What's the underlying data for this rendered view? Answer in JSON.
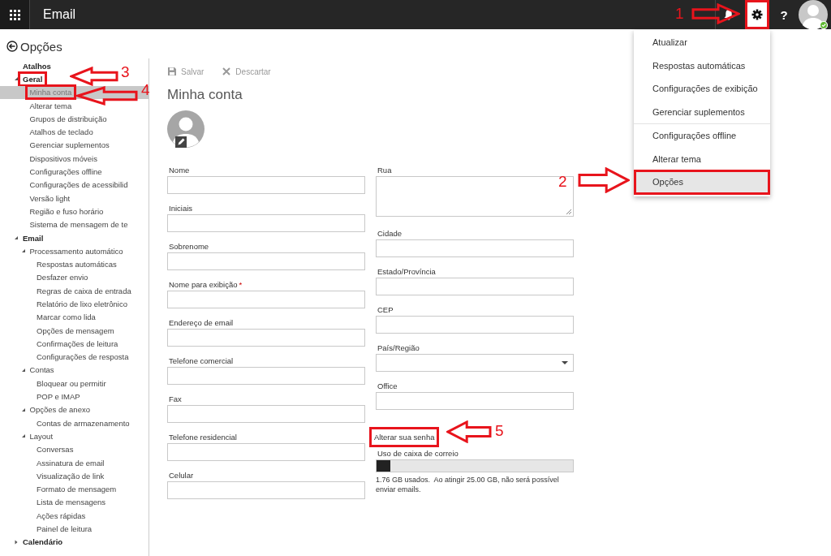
{
  "top_bar": {
    "app_title": "Email",
    "help_label": "?",
    "settings_open": true,
    "settings_highlighted": true
  },
  "nav": {
    "back_title": "Opções",
    "items": [
      {
        "label": "Atalhos",
        "selected": false,
        "highlighted": false
      },
      {
        "label": "Geral",
        "expanded": true,
        "selected": false,
        "highlighted": true,
        "children": [
          {
            "label": "Minha conta",
            "selected": true,
            "highlighted": true
          },
          {
            "label": "Alterar tema",
            "selected": false,
            "highlighted": false
          },
          {
            "label": "Grupos de distribuição",
            "selected": false,
            "highlighted": false
          },
          {
            "label": "Atalhos de teclado",
            "selected": false,
            "highlighted": false
          },
          {
            "label": "Gerenciar suplementos",
            "selected": false,
            "highlighted": false
          },
          {
            "label": "Dispositivos móveis",
            "selected": false,
            "highlighted": false
          },
          {
            "label": "Configurações offline",
            "selected": false,
            "highlighted": false
          },
          {
            "label": "Configurações de acessibilid",
            "selected": false,
            "highlighted": false
          },
          {
            "label": "Versão light",
            "selected": false,
            "highlighted": false
          },
          {
            "label": "Região e fuso horário",
            "selected": false,
            "highlighted": false
          },
          {
            "label": "Sistema de mensagem de te",
            "selected": false,
            "highlighted": false
          }
        ]
      },
      {
        "label": "Email",
        "expanded": true,
        "selected": false,
        "highlighted": false,
        "children": [
          {
            "label": "Processamento automático",
            "expanded": true,
            "selected": false,
            "highlighted": false,
            "children": [
              {
                "label": "Respostas automáticas",
                "selected": false,
                "highlighted": false
              },
              {
                "label": "Desfazer envio",
                "selected": false,
                "highlighted": false
              },
              {
                "label": "Regras de caixa de entrada",
                "selected": false,
                "highlighted": false
              },
              {
                "label": "Relatório de lixo eletrônico",
                "selected": false,
                "highlighted": false
              },
              {
                "label": "Marcar como lida",
                "selected": false,
                "highlighted": false
              },
              {
                "label": "Opções de mensagem",
                "selected": false,
                "highlighted": false
              },
              {
                "label": "Confirmações de leitura",
                "selected": false,
                "highlighted": false
              },
              {
                "label": "Configurações de resposta",
                "selected": false,
                "highlighted": false
              }
            ]
          },
          {
            "label": "Contas",
            "expanded": true,
            "selected": false,
            "highlighted": false,
            "children": [
              {
                "label": "Bloquear ou permitir",
                "selected": false,
                "highlighted": false
              },
              {
                "label": "POP e IMAP",
                "selected": false,
                "highlighted": false
              }
            ]
          },
          {
            "label": "Opções de anexo",
            "expanded": true,
            "selected": false,
            "highlighted": false,
            "children": [
              {
                "label": "Contas de armazenamento",
                "selected": false,
                "highlighted": false
              }
            ]
          },
          {
            "label": "Layout",
            "expanded": true,
            "selected": false,
            "highlighted": false,
            "children": [
              {
                "label": "Conversas",
                "selected": false,
                "highlighted": false
              },
              {
                "label": "Assinatura de email",
                "selected": false,
                "highlighted": false
              },
              {
                "label": "Visualização de link",
                "selected": false,
                "highlighted": false
              },
              {
                "label": "Formato de mensagem",
                "selected": false,
                "highlighted": false
              },
              {
                "label": "Lista de mensagens",
                "selected": false,
                "highlighted": false
              },
              {
                "label": "Ações rápidas",
                "selected": false,
                "highlighted": false
              },
              {
                "label": "Painel de leitura",
                "selected": false,
                "highlighted": false
              }
            ]
          }
        ]
      },
      {
        "label": "Calendário",
        "expanded": false,
        "selected": false,
        "highlighted": false
      }
    ]
  },
  "toolbar": [
    {
      "kind": "save",
      "label": "Salvar",
      "disabled": true
    },
    {
      "kind": "discard",
      "label": "Descartar",
      "disabled": true
    }
  ],
  "page_title": "Minha conta",
  "form": {
    "left": [
      {
        "kind": "text",
        "label": "Nome"
      },
      {
        "kind": "text",
        "label": "Iniciais"
      },
      {
        "kind": "text",
        "label": "Sobrenome"
      },
      {
        "kind": "text",
        "label": "Nome para exibição",
        "required_mark": "*"
      },
      {
        "kind": "text",
        "label": "Endereço de email"
      },
      {
        "kind": "text",
        "label": "Telefone comercial"
      },
      {
        "kind": "text",
        "label": "Fax"
      },
      {
        "kind": "text",
        "label": "Telefone residencial"
      },
      {
        "kind": "text",
        "label": "Celular"
      }
    ],
    "right": [
      {
        "kind": "textarea",
        "label": "Rua"
      },
      {
        "kind": "text",
        "label": "Cidade"
      },
      {
        "kind": "text",
        "label": "Estado/Província"
      },
      {
        "kind": "text",
        "label": "CEP"
      },
      {
        "kind": "select",
        "label": "País/Região"
      },
      {
        "kind": "text",
        "label": "Office"
      }
    ],
    "change_password": {
      "label": "Alterar sua senha",
      "highlighted": true
    },
    "mailbox": {
      "label": "Uso de caixa de correio",
      "level": 0.07,
      "note": "1.76 GB usados.  Ao atingir 25.00 GB, não será possível enviar emails."
    }
  },
  "settings_menu": {
    "groups": [
      [
        {
          "label": "Atualizar",
          "selected": false,
          "highlighted": false
        },
        {
          "label": "Respostas automáticas",
          "selected": false,
          "highlighted": false
        },
        {
          "label": "Configurações de exibição",
          "selected": false,
          "highlighted": false
        },
        {
          "label": "Gerenciar suplementos",
          "selected": false,
          "highlighted": false
        }
      ],
      [
        {
          "label": "Configurações offline",
          "selected": false,
          "highlighted": false
        },
        {
          "label": "Alterar tema",
          "selected": false,
          "highlighted": false
        },
        {
          "label": "Opções",
          "selected": true,
          "highlighted": true
        }
      ]
    ]
  },
  "annotations": [
    {
      "number": "1"
    },
    {
      "number": "2"
    },
    {
      "number": "3"
    },
    {
      "number": "4"
    },
    {
      "number": "5"
    }
  ]
}
